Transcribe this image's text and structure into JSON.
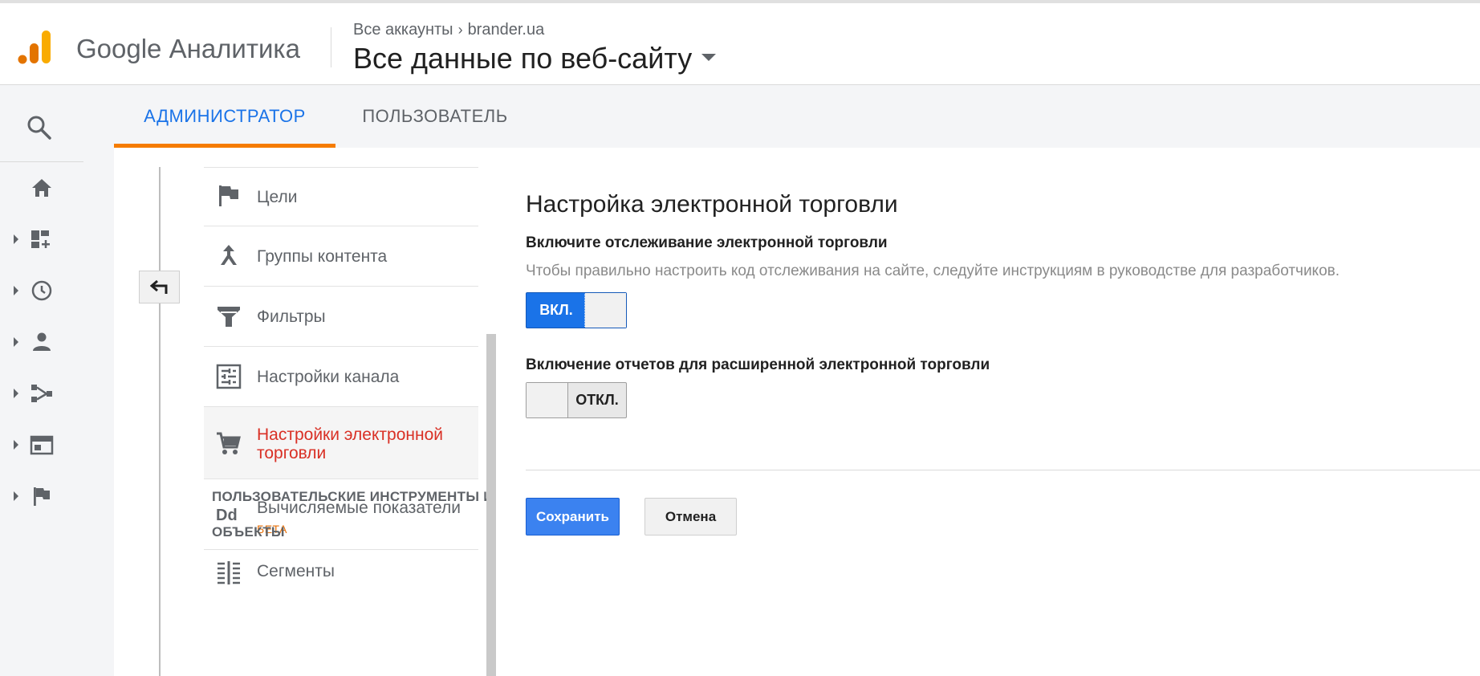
{
  "header": {
    "brand": "Google Аналитика",
    "breadcrumb": {
      "account": "Все аккаунты",
      "property": "brander.ua"
    },
    "view": "Все данные по веб-сайту"
  },
  "tabs": [
    {
      "label": "АДМИНИСТРАТОР",
      "active": true
    },
    {
      "label": "ПОЛЬЗОВАТЕЛЬ",
      "active": false
    }
  ],
  "left_nav": {
    "icons": [
      "search-icon",
      "home-icon",
      "customization-icon",
      "realtime-icon",
      "audience-icon",
      "acquisition-icon",
      "behavior-icon",
      "conversions-icon"
    ]
  },
  "menu": {
    "items": [
      {
        "label": "Цели",
        "icon": "flag-icon"
      },
      {
        "label": "Группы контента",
        "icon": "content-groups-icon"
      },
      {
        "label": "Фильтры",
        "icon": "filter-icon"
      },
      {
        "label": "Настройки канала",
        "icon": "channel-settings-icon"
      },
      {
        "label": "Настройки электронной торговли",
        "icon": "cart-icon",
        "active": true
      },
      {
        "label": "Вычисляемые показатели",
        "badge": "БЕТА",
        "icon": "calculated-metrics-icon"
      }
    ],
    "section_heading_line1": "ПОЛЬЗОВАТЕЛЬСКИЕ ИНСТРУМЕНТЫ И",
    "section_heading_line2": "ОБЪЕКТЫ",
    "section_items": [
      {
        "label": "Сегменты",
        "icon": "segments-icon"
      }
    ]
  },
  "settings": {
    "title": "Настройка электронной торговли",
    "ecommerce": {
      "label": "Включите отслеживание электронной торговли",
      "hint": "Чтобы правильно настроить код отслеживания на сайте, следуйте инструкциям в руководстве для разработчиков.",
      "state": "ВКЛ.",
      "enabled": true
    },
    "enhanced": {
      "label": "Включение отчетов для расширенной электронной торговли",
      "state": "ОТКЛ.",
      "enabled": false
    },
    "save_label": "Сохранить",
    "cancel_label": "Отмена"
  },
  "colors": {
    "accent_blue": "#1a73e8",
    "tab_underline": "#f57c00",
    "active_menu_text": "#d93025",
    "beta": "#e8710a"
  }
}
